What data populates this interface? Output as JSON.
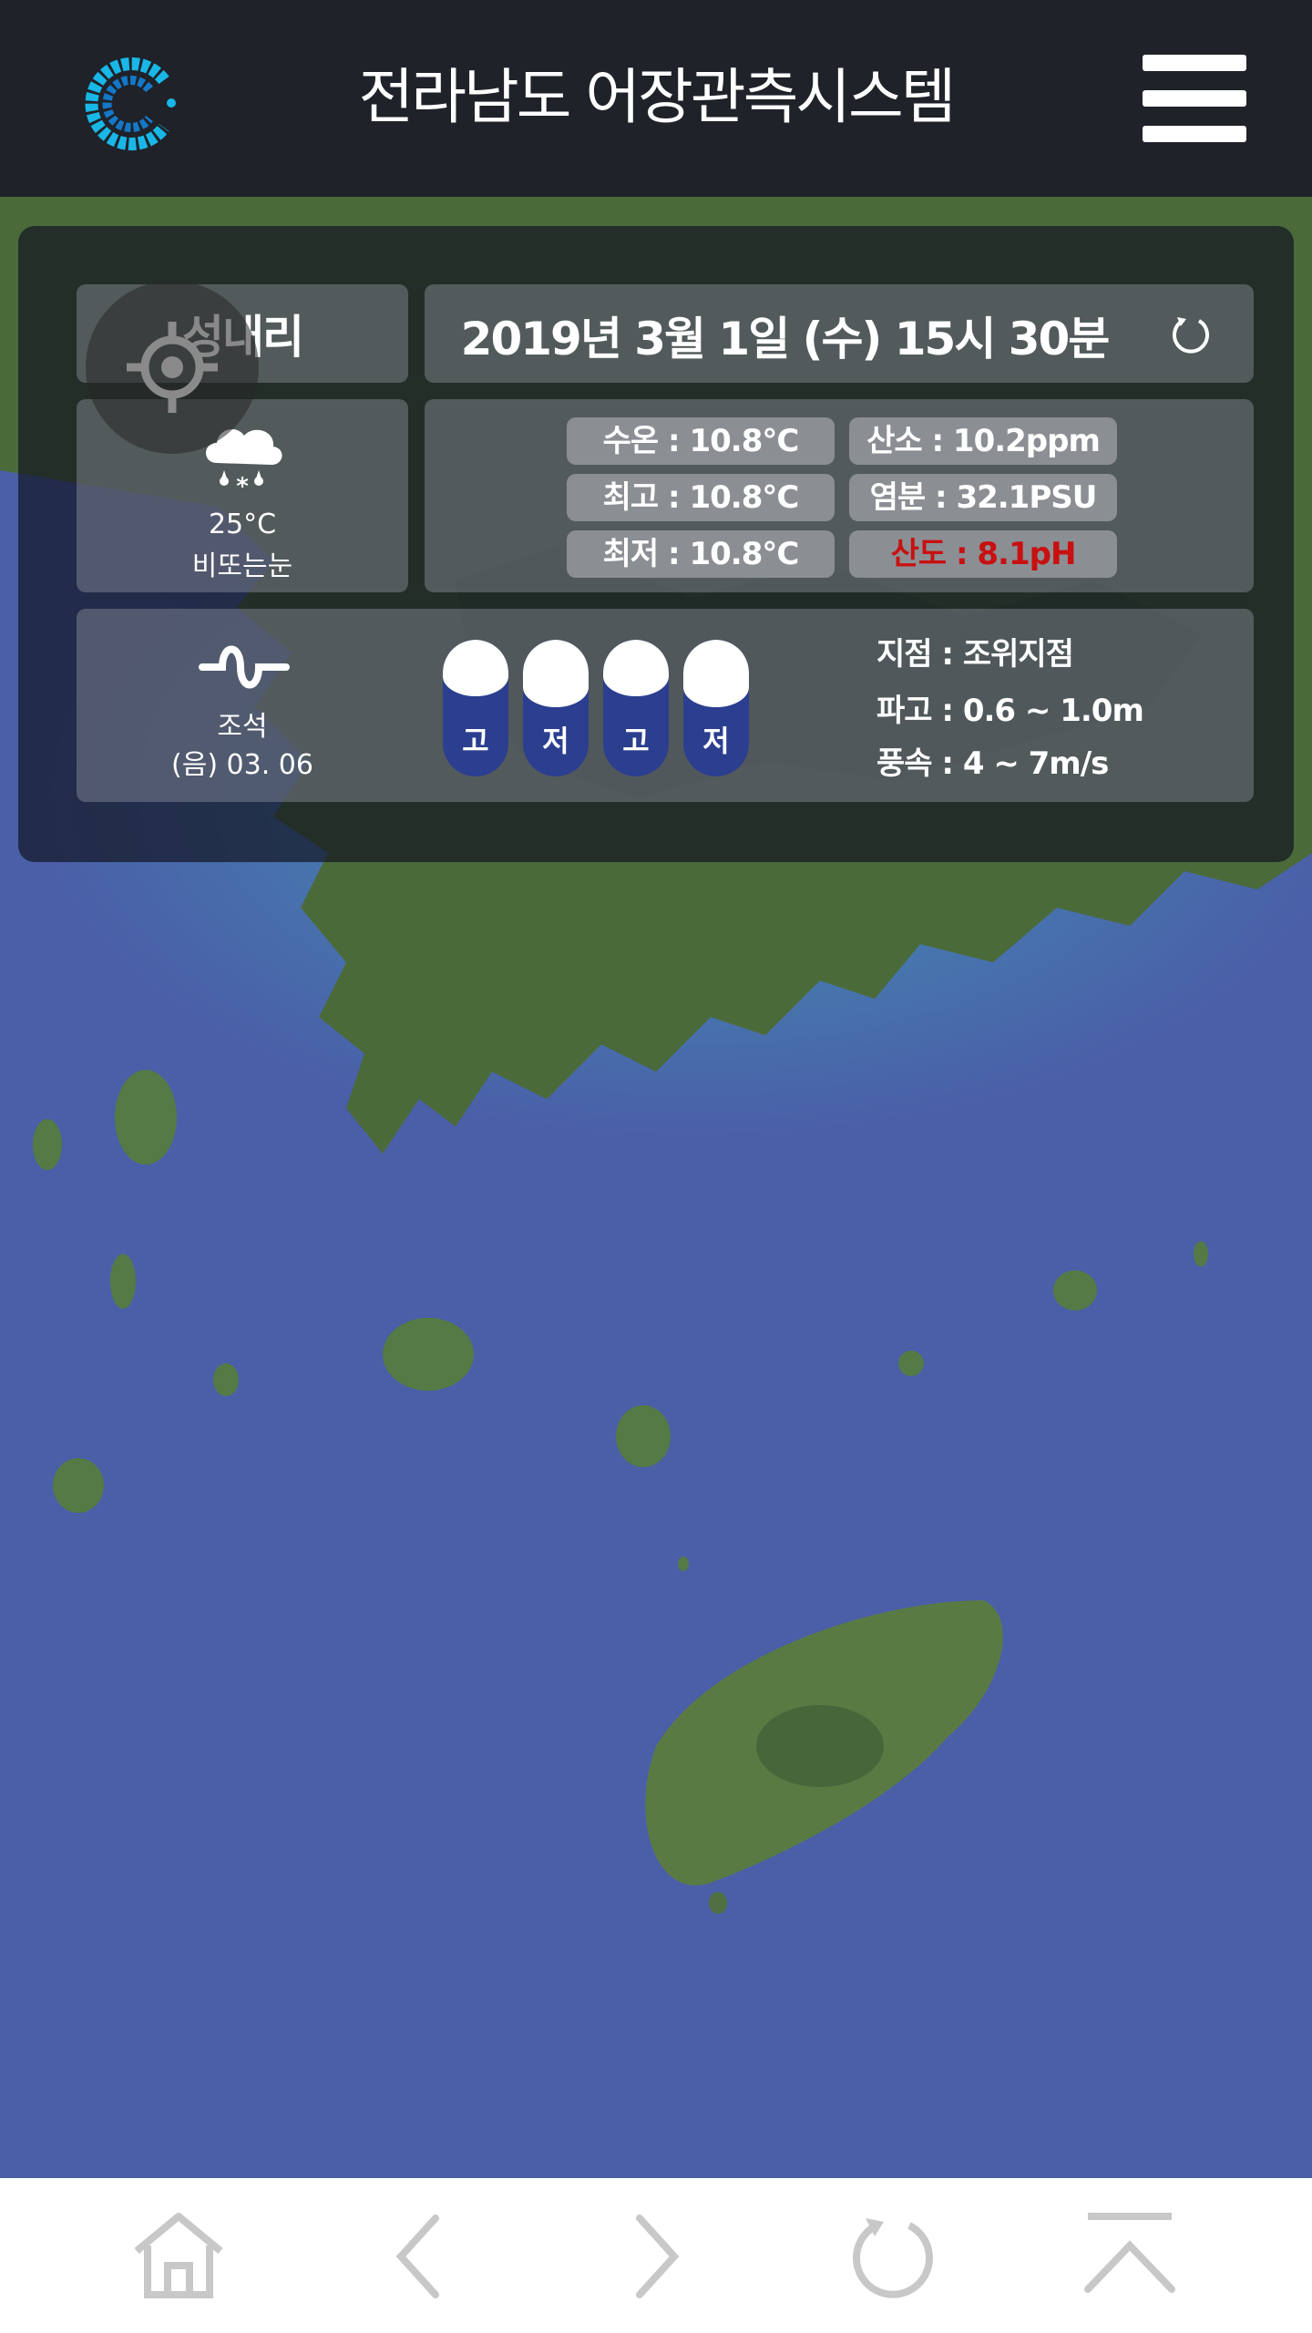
{
  "header": {
    "title": "전라남도 어장관측시스템",
    "logo_icon": "c-logo-icon",
    "menu_icon": "hamburger-menu-icon"
  },
  "station": {
    "name": "성내리",
    "datetime": "2019년 3월 1일 (수) 15시 30분",
    "refresh_icon": "refresh-icon",
    "locate_icon": "locate-crosshair-icon"
  },
  "weather": {
    "icon": "rain-snow-cloud-icon",
    "temp": "25°C",
    "desc": "비또는눈"
  },
  "metrics": [
    {
      "text": "수온 : 10.8°C",
      "color": "#ffffff"
    },
    {
      "text": "산소 : 10.2ppm",
      "color": "#ffffff"
    },
    {
      "text": "최고 : 10.8°C",
      "color": "#ffffff"
    },
    {
      "text": "염분 : 32.1PSU",
      "color": "#ffffff"
    },
    {
      "text": "최저 : 10.8°C",
      "color": "#ffffff"
    },
    {
      "text": "산도 : 8.1pH",
      "color": "#c81010"
    }
  ],
  "tide": {
    "icon": "tide-wave-icon",
    "label": "조석",
    "date": "(음) 03. 06",
    "phases": [
      "고",
      "저",
      "고",
      "저"
    ],
    "info": [
      "지점 : 조위지점",
      "파고 : 0.6 ~ 1.0m",
      "풍속 : 4 ~ 7m/s"
    ]
  },
  "colors": {
    "header_bg": "#1f2229",
    "tide_capsule": "#2b3e8f",
    "sea": "#4a5fa8",
    "nav_icon": "#c8c8c8",
    "alert_text": "#c81010"
  },
  "bottom_nav": [
    "home-icon",
    "back-arrow-icon",
    "forward-arrow-icon",
    "reload-icon",
    "scroll-top-icon"
  ]
}
